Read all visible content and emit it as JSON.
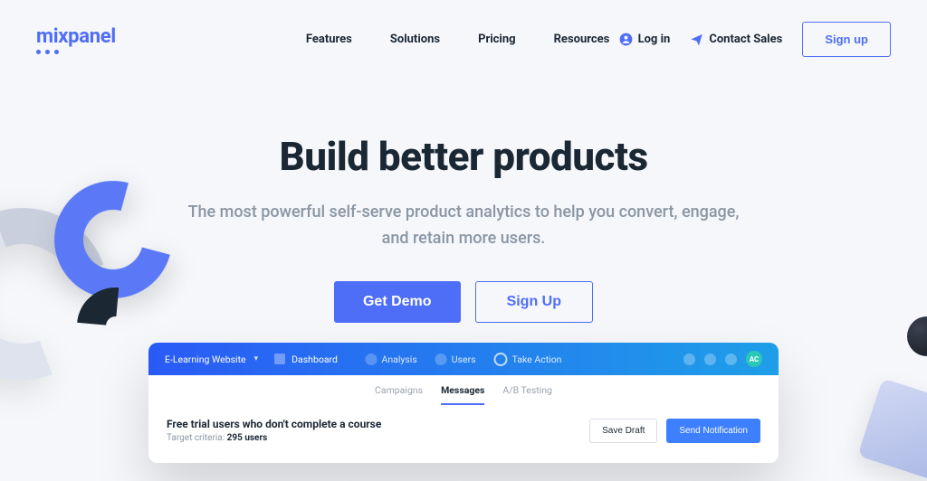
{
  "brand": {
    "name": "mixpanel"
  },
  "nav": {
    "items": [
      "Features",
      "Solutions",
      "Pricing",
      "Resources"
    ]
  },
  "actions": {
    "login": "Log in",
    "contact": "Contact Sales",
    "signup": "Sign up"
  },
  "hero": {
    "headline": "Build better products",
    "subhead": "The most powerful self-serve product analytics to help you convert, engage, and retain more users.",
    "cta_primary": "Get Demo",
    "cta_secondary": "Sign Up"
  },
  "app": {
    "project": "E-Learning Website",
    "crumb": "Dashboard",
    "nav": {
      "analysis": "Analysis",
      "users": "Users",
      "take_action": "Take Action"
    },
    "avatar": "AC",
    "tabs": {
      "campaigns": "Campaigns",
      "messages": "Messages",
      "ab": "A/B Testing"
    },
    "message": {
      "title": "Free trial users who don't complete a course",
      "criteria_label": "Target criteria:",
      "criteria_value": "295 users"
    },
    "buttons": {
      "draft": "Save Draft",
      "send": "Send Notification"
    }
  }
}
